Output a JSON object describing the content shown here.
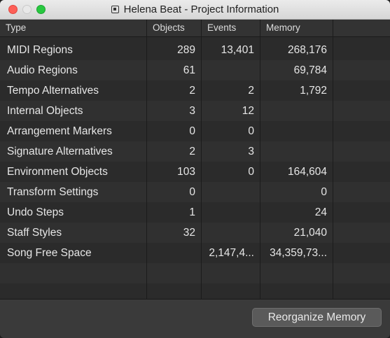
{
  "window": {
    "title": "Helena Beat - Project Information"
  },
  "columns": {
    "type": "Type",
    "objects": "Objects",
    "events": "Events",
    "memory": "Memory"
  },
  "rows": [
    {
      "type": "MIDI Regions",
      "objects": "289",
      "events": "13,401",
      "memory": "268,176"
    },
    {
      "type": "Audio Regions",
      "objects": "61",
      "events": "",
      "memory": "69,784"
    },
    {
      "type": "Tempo Alternatives",
      "objects": "2",
      "events": "2",
      "memory": "1,792"
    },
    {
      "type": "Internal Objects",
      "objects": "3",
      "events": "12",
      "memory": ""
    },
    {
      "type": "Arrangement Markers",
      "objects": "0",
      "events": "0",
      "memory": ""
    },
    {
      "type": "Signature Alternatives",
      "objects": "2",
      "events": "3",
      "memory": ""
    },
    {
      "type": "Environment Objects",
      "objects": "103",
      "events": "0",
      "memory": "164,604"
    },
    {
      "type": "Transform Settings",
      "objects": "0",
      "events": "",
      "memory": "0"
    },
    {
      "type": "Undo Steps",
      "objects": "1",
      "events": "",
      "memory": "24"
    },
    {
      "type": "Staff Styles",
      "objects": "32",
      "events": "",
      "memory": "21,040"
    },
    {
      "type": "Song Free Space",
      "objects": "",
      "events": "2,147,4...",
      "memory": "34,359,73..."
    }
  ],
  "footer": {
    "reorganize_label": "Reorganize Memory"
  }
}
